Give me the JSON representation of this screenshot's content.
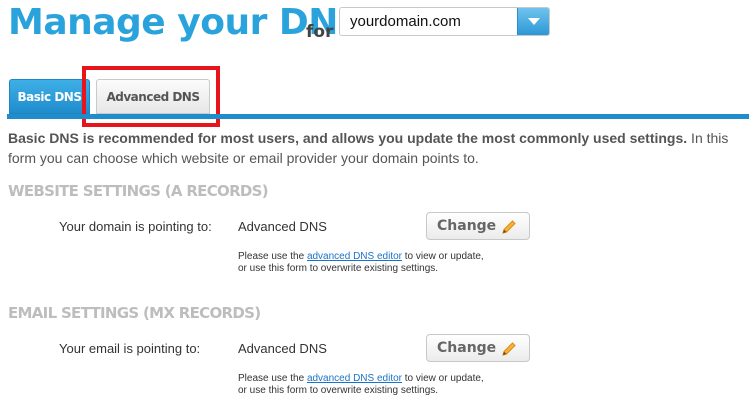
{
  "header": {
    "title": "Manage your DNS",
    "for_label": "for",
    "domain_select": {
      "value": "yourdomain.com"
    }
  },
  "tabs": [
    {
      "label": "Basic DNS",
      "active": true
    },
    {
      "label": "Advanced DNS",
      "active": false
    }
  ],
  "intro": {
    "bold": "Basic DNS is recommended for most users, and allows you update the most commonly used settings.",
    "rest": " In this form you can choose which website or email provider your domain points to."
  },
  "website": {
    "heading": "WEBSITE SETTINGS (A RECORDS)",
    "label": "Your domain is pointing to:",
    "value": "Advanced DNS",
    "button": "Change",
    "note_before": "Please use the ",
    "note_link": "advanced DNS editor",
    "note_after": " to view or update,",
    "note_line2": "or use this form to overwrite existing settings."
  },
  "email": {
    "heading": "EMAIL SETTINGS (MX RECORDS)",
    "label": "Your email is pointing to:",
    "value": "Advanced DNS",
    "button": "Change",
    "note_before": "Please use the ",
    "note_link": "advanced DNS editor",
    "note_after": " to view or update,",
    "note_line2": "or use this form to overwrite existing settings."
  },
  "colors": {
    "brand_blue": "#2aa3dd",
    "highlight_red": "#e8141b",
    "pencil_orange": "#f0a020"
  },
  "icons": {
    "select_arrow": "chevron-down-icon",
    "edit": "pencil-icon"
  }
}
